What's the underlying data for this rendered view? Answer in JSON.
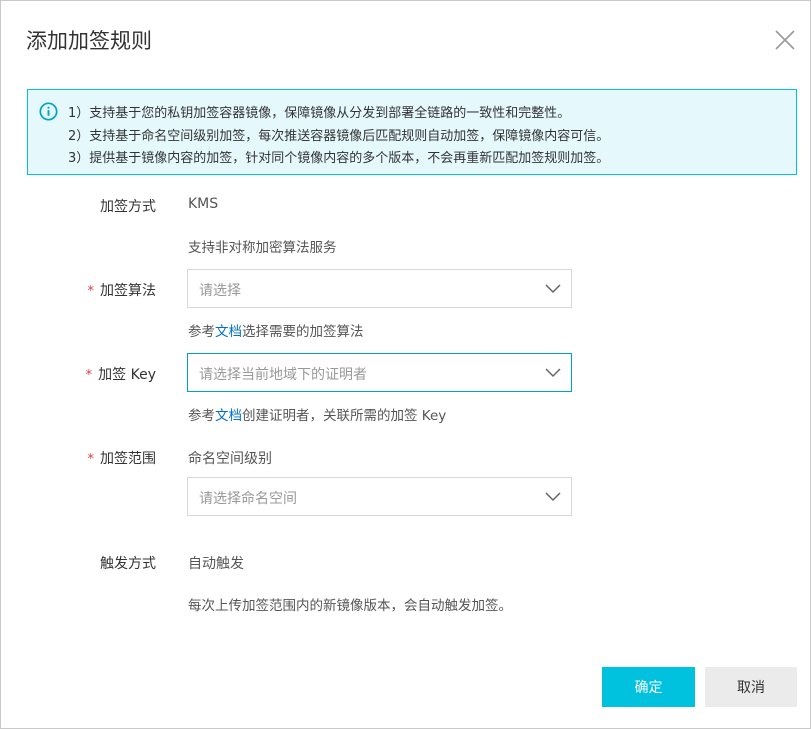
{
  "dialog": {
    "title": "添加加签规则"
  },
  "notice": {
    "lines": [
      "1）支持基于您的私钥加签容器镜像，保障镜像从分发到部署全链路的一致性和完整性。",
      "2）支持基于命名空间级别加签，每次推送容器镜像后匹配规则自动加签，保障镜像内容可信。",
      "3）提供基于镜像内容的加签，针对同个镜像内容的多个版本，不会再重新匹配加签规则加签。"
    ]
  },
  "form": {
    "method": {
      "label": "加签方式",
      "value": "KMS",
      "help": "支持非对称加密算法服务"
    },
    "algorithm": {
      "required_mark": "*",
      "label": "加签算法",
      "placeholder": "请选择",
      "help_prefix": "参考",
      "help_link": "文档",
      "help_suffix": "选择需要的加签算法"
    },
    "key": {
      "required_mark": "*",
      "label": "加签 Key",
      "placeholder": "请选择当前地域下的证明者",
      "help_prefix": "参考",
      "help_link": "文档",
      "help_suffix": "创建证明者，关联所需的加签 Key"
    },
    "scope": {
      "required_mark": "*",
      "label": "加签范围",
      "value": "命名空间级别",
      "placeholder": "请选择命名空间"
    },
    "trigger": {
      "label": "触发方式",
      "value": "自动触发",
      "help": "每次上传加签范围内的新镜像版本，会自动触发加签。"
    }
  },
  "footer": {
    "confirm_label": "确定",
    "cancel_label": "取消"
  },
  "colors": {
    "primary": "#00c1de",
    "link": "#0070cc",
    "required": "#e4393c",
    "notice_bg": "#e5f9fd"
  },
  "icons": {
    "close": "close-icon",
    "info": "info-icon",
    "select_arrow": "chevron-down-icon"
  }
}
